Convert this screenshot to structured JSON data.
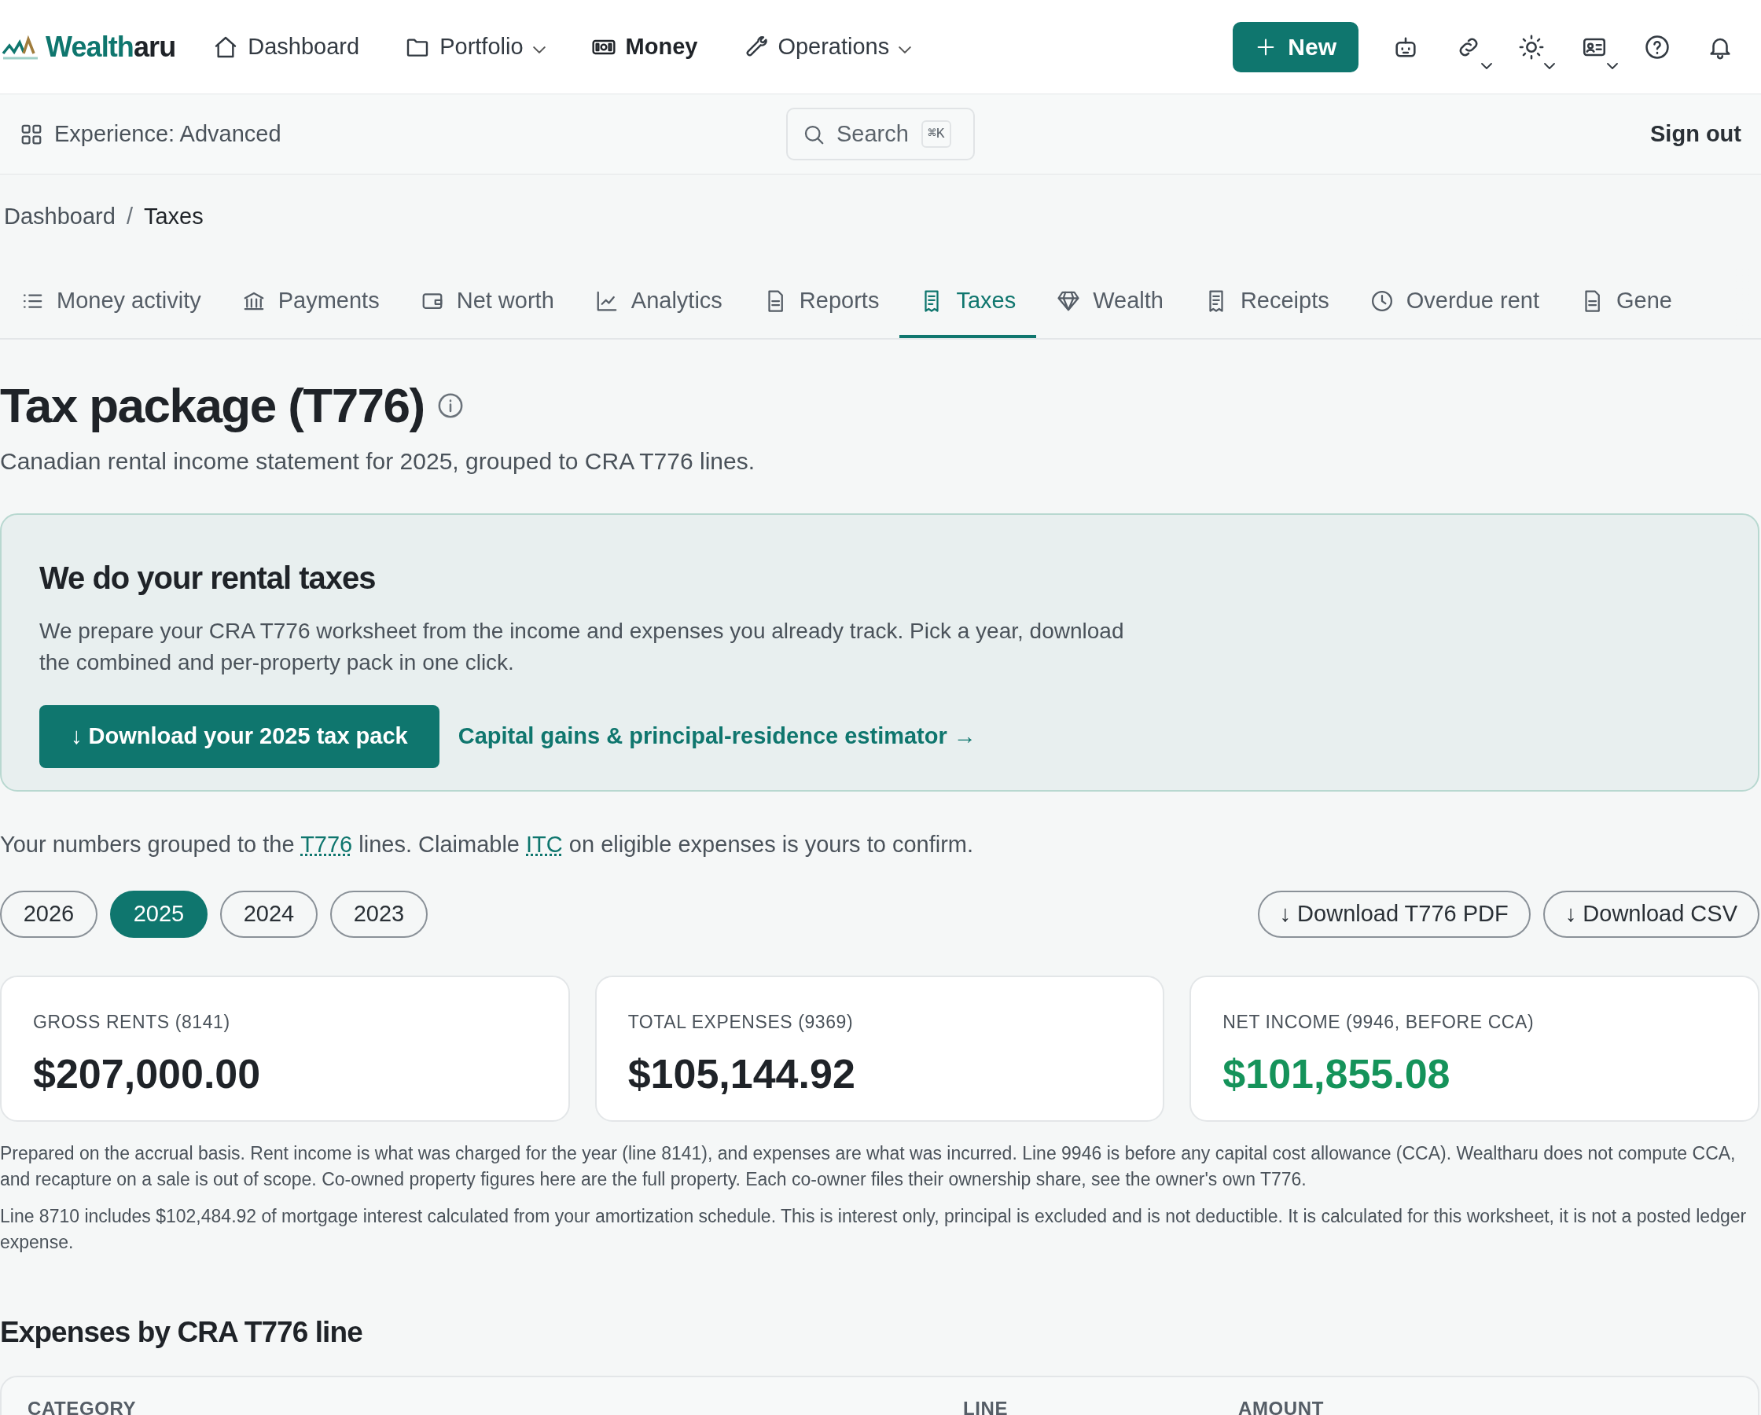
{
  "brand": {
    "name_part1": "Wealth",
    "name_part2": "aru"
  },
  "nav": [
    {
      "label": "Dashboard",
      "dropdown": false,
      "selected": false
    },
    {
      "label": "Portfolio",
      "dropdown": true,
      "selected": false
    },
    {
      "label": "Money",
      "dropdown": false,
      "selected": true
    },
    {
      "label": "Operations",
      "dropdown": true,
      "selected": false
    }
  ],
  "new_button": {
    "label": "New"
  },
  "toolbar_icons": [
    {
      "dropdown": false
    },
    {
      "dropdown": true
    },
    {
      "dropdown": true
    },
    {
      "dropdown": true
    },
    {
      "dropdown": false
    },
    {
      "dropdown": false
    }
  ],
  "subbar": {
    "experience": "Experience: Advanced",
    "search": {
      "placeholder": "Search",
      "shortcut": "⌘K"
    },
    "sign_out": "Sign out"
  },
  "breadcrumb": [
    {
      "label": "Dashboard",
      "current": false
    },
    {
      "label": "Taxes",
      "current": true
    }
  ],
  "breadcrumb_separator": "/",
  "tabs": [
    {
      "label": "Money activity",
      "selected": false
    },
    {
      "label": "Payments",
      "selected": false
    },
    {
      "label": "Net worth",
      "selected": false
    },
    {
      "label": "Analytics",
      "selected": false
    },
    {
      "label": "Reports",
      "selected": false
    },
    {
      "label": "Taxes",
      "selected": true
    },
    {
      "label": "Wealth",
      "selected": false
    },
    {
      "label": "Receipts",
      "selected": false
    },
    {
      "label": "Overdue rent",
      "selected": false
    },
    {
      "label": "Gene",
      "selected": false
    }
  ],
  "page": {
    "title": "Tax package (T776)",
    "subtitle": "Canadian rental income statement for 2025, grouped to CRA T776 lines."
  },
  "banner": {
    "title": "We do your rental taxes",
    "text": "We prepare your CRA T776 worksheet from the income and expenses you already track. Pick a year, download the combined and per-property pack in one click.",
    "primary_button": "↓ Download your 2025 tax pack",
    "link": "Capital gains & principal-residence estimator →"
  },
  "intro": {
    "before": "Your numbers grouped to the ",
    "link1": "T776",
    "middle": " lines. Claimable ",
    "link2": "ITC",
    "after": " on eligible expenses is yours to confirm."
  },
  "years": [
    {
      "label": "2026",
      "selected": false
    },
    {
      "label": "2025",
      "selected": true
    },
    {
      "label": "2024",
      "selected": false
    },
    {
      "label": "2023",
      "selected": false
    }
  ],
  "downloads": [
    "↓ Download T776 PDF",
    "↓ Download CSV"
  ],
  "summary": [
    {
      "label": "GROSS RENTS (8141)",
      "value": "$207,000.00",
      "positive": false
    },
    {
      "label": "TOTAL EXPENSES (9369)",
      "value": "$105,144.92",
      "positive": false
    },
    {
      "label": "NET INCOME (9946, BEFORE CCA)",
      "value": "$101,855.08",
      "positive": true
    }
  ],
  "notes": [
    "Prepared on the accrual basis. Rent income is what was charged for the year (line 8141), and expenses are what was incurred. Line 9946 is before any capital cost allowance (CCA). Wealtharu does not compute CCA, and recapture on a sale is out of scope. Co-owned property figures here are the full property. Each co-owner files their ownership share, see the owner's own T776.",
    "Line 8710 includes $102,484.92 of mortgage interest calculated from your amortization schedule. This is interest only, principal is excluded and is not deductible. It is calculated for this worksheet, it is not a posted ledger expense."
  ],
  "expenses": {
    "title": "Expenses by CRA T776 line",
    "columns": [
      "CATEGORY",
      "LINE",
      "AMOUNT"
    ]
  }
}
